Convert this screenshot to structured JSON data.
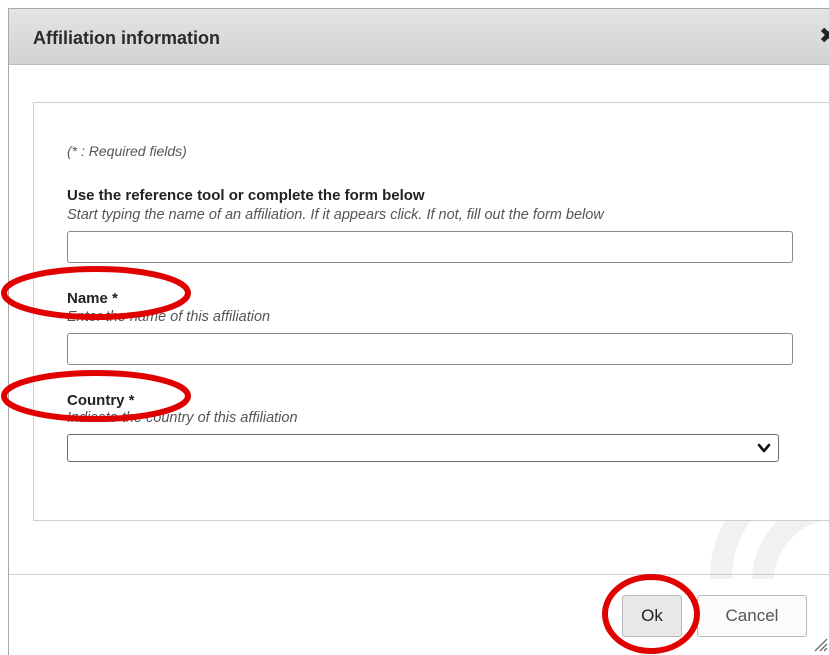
{
  "dialog": {
    "title": "Affiliation information",
    "close_icon": "close-icon"
  },
  "form": {
    "required_note": "(* : Required fields)",
    "reference": {
      "label": "Use the reference tool or complete the form below",
      "hint": "Start typing the name of an affiliation. If it appears click. If not, fill out the form below",
      "value": ""
    },
    "name": {
      "label": "Name *",
      "hint": "Enter the name of this affiliation",
      "value": ""
    },
    "country": {
      "label": "Country *",
      "hint": "Indicate the country of this affiliation",
      "selected": ""
    }
  },
  "footer": {
    "ok_label": "Ok",
    "cancel_label": "Cancel"
  },
  "annotations": {
    "color": "#e00000",
    "highlighted": [
      "Name *",
      "Country *",
      "Ok"
    ]
  }
}
